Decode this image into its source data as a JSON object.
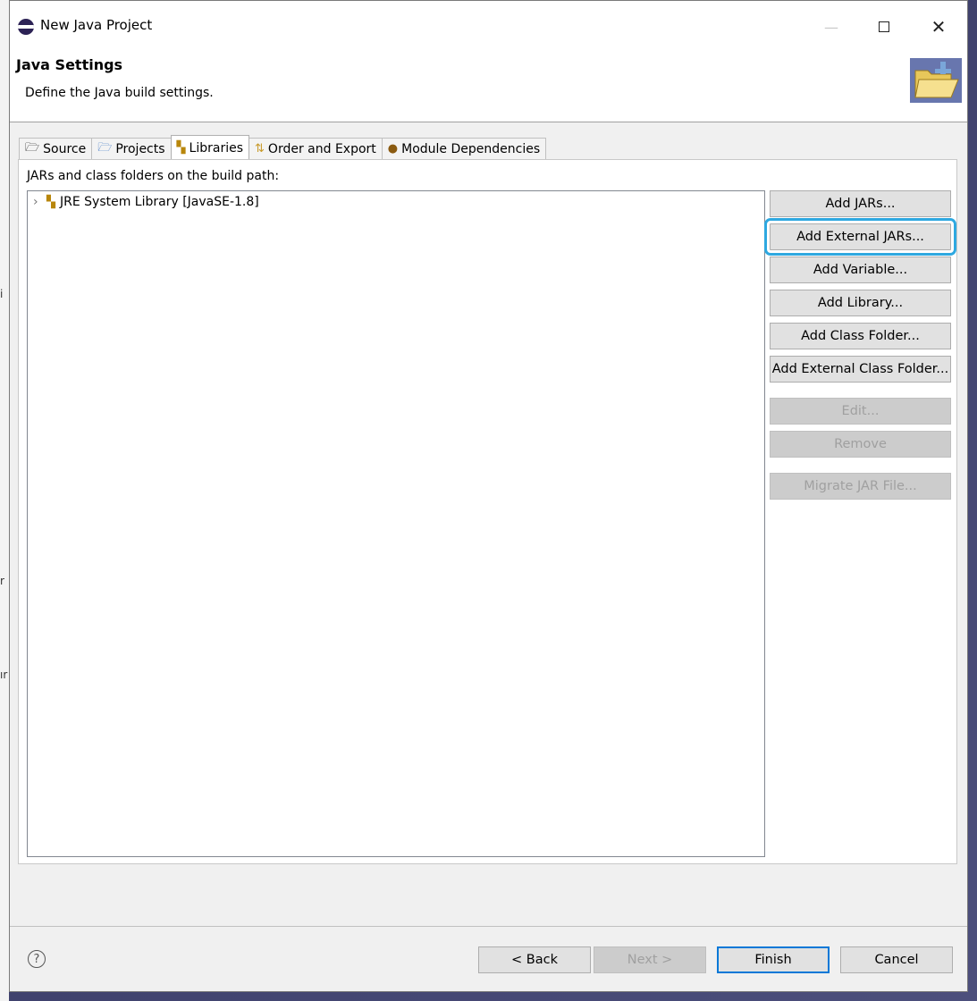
{
  "window": {
    "title": "New Java Project"
  },
  "header": {
    "title": "Java Settings",
    "description": "Define the Java build settings."
  },
  "tabs": [
    {
      "label": "Source",
      "icon": "source-folder-icon"
    },
    {
      "label": "Projects",
      "icon": "projects-folder-icon"
    },
    {
      "label": "Libraries",
      "icon": "libraries-icon",
      "active": true
    },
    {
      "label": "Order and Export",
      "icon": "order-export-icon"
    },
    {
      "label": "Module Dependencies",
      "icon": "module-icon"
    }
  ],
  "libraries": {
    "label": "JARs and class folders on the build path:",
    "tree": [
      {
        "label": "JRE System Library [JavaSE-1.8]",
        "icon": "library-icon"
      }
    ],
    "buttons": {
      "add_jars": "Add JARs...",
      "add_external_jars": "Add External JARs...",
      "add_variable": "Add Variable...",
      "add_library": "Add Library...",
      "add_class_folder": "Add Class Folder...",
      "add_external_class_folder": "Add External Class Folder...",
      "edit": "Edit...",
      "remove": "Remove",
      "migrate_jar": "Migrate JAR File..."
    }
  },
  "footer": {
    "back": "< Back",
    "next": "Next >",
    "finish": "Finish",
    "cancel": "Cancel"
  },
  "colors": {
    "focus_outline": "#2ea8e0",
    "default_button_border": "#0078d7"
  }
}
